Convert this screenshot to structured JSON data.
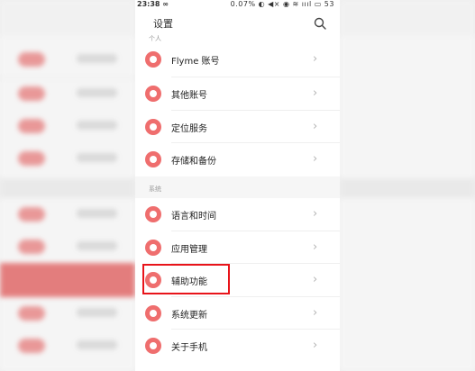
{
  "status_bar": {
    "time": "23:38 ∞",
    "right": "0.07% ◐ ◀× ◉ ≋ ıııl ▭ 53"
  },
  "header": {
    "title": "设置",
    "search_icon": "search-icon"
  },
  "sections": [
    {
      "label": "个人"
    },
    {
      "label": "系统"
    }
  ],
  "items": [
    {
      "label": "Flyme 账号",
      "icon": "flyme-account-icon"
    },
    {
      "label": "其他账号",
      "icon": "other-accounts-icon"
    },
    {
      "label": "定位服务",
      "icon": "location-icon"
    },
    {
      "label": "存储和备份",
      "icon": "cloud-backup-icon"
    },
    {
      "label": "语言和时间",
      "icon": "globe-icon"
    },
    {
      "label": "应用管理",
      "icon": "app-manager-icon"
    },
    {
      "label": "辅助功能",
      "icon": "accessibility-icon"
    },
    {
      "label": "系统更新",
      "icon": "system-update-icon"
    },
    {
      "label": "关于手机",
      "icon": "info-icon"
    }
  ],
  "colors": {
    "accent": "#ef6e6e",
    "highlight_border": "#e8141a"
  }
}
